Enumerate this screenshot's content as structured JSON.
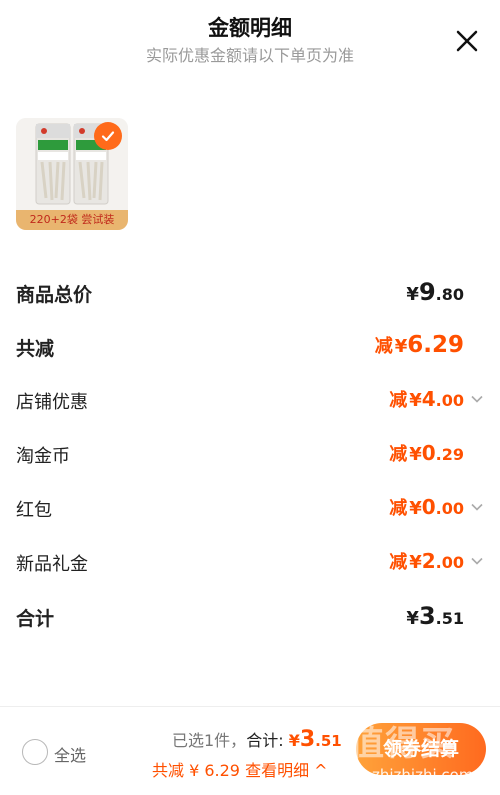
{
  "header": {
    "title": "金额明细",
    "subtitle": "实际优惠金额请以下单页为准"
  },
  "product": {
    "caption": "220+2袋 尝试装",
    "selected": true
  },
  "rows": {
    "total_price": {
      "label": "商品总价",
      "currency": "¥",
      "int": "9",
      "dec": ".80"
    },
    "total_discount": {
      "label": "共减",
      "prefix": "减",
      "currency": "¥",
      "int": "6",
      "dec": ".29"
    },
    "shop_discount": {
      "label": "店铺优惠",
      "prefix": "减",
      "currency": "¥",
      "int": "4",
      "dec": ".00"
    },
    "taojinbi": {
      "label": "淘金币",
      "prefix": "减",
      "currency": "¥",
      "int": "0",
      "dec": ".29"
    },
    "red_packet": {
      "label": "红包",
      "prefix": "减",
      "currency": "¥",
      "int": "0",
      "dec": ".00"
    },
    "new_gift": {
      "label": "新品礼金",
      "prefix": "减",
      "currency": "¥",
      "int": "2",
      "dec": ".00"
    },
    "subtotal": {
      "label": "合计",
      "currency": "¥",
      "int": "3",
      "dec": ".51"
    }
  },
  "footer": {
    "select_all": "全选",
    "selected_count": "已选1件，",
    "total_label": "合计:",
    "total_currency": "¥",
    "total_int": "3",
    "total_dec": ".51",
    "detail_link": "共减 ¥ 6.29  查看明细 ^",
    "checkout_label": "领券结算",
    "watermark": "值得买",
    "watermark_url": "zhizhizhi.com"
  },
  "colors": {
    "accent": "#ff5000",
    "button_start": "#ffa23a",
    "button_end": "#ff6a1f",
    "muted": "#9a9a9a"
  }
}
